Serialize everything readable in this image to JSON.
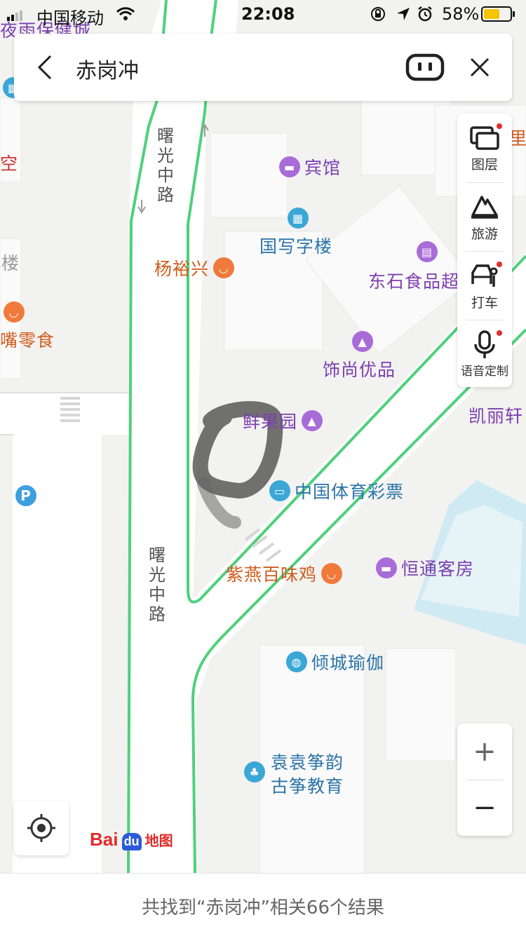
{
  "status_bar": {
    "carrier": "中国移动",
    "time": "22:08",
    "battery": "58%",
    "edge_label": "夜雨保健城"
  },
  "search": {
    "query": "赤岗冲"
  },
  "toolbar": {
    "items": [
      {
        "label": "图层",
        "icon": "layers-icon",
        "badge": true
      },
      {
        "label": "旅游",
        "icon": "travel-icon",
        "badge": false
      },
      {
        "label": "打车",
        "icon": "taxi-icon",
        "badge": true
      },
      {
        "label": "语音定制",
        "icon": "microphone-icon",
        "badge": true
      }
    ]
  },
  "roads": {
    "road1": "曙光中路",
    "road2": "曙光中路"
  },
  "pois": {
    "hotel1": "宾馆",
    "office": "国写字楼",
    "restaurant1": "杨裕兴",
    "food_store": "东石食品超",
    "snack": "嘴零食",
    "building": "楼",
    "accessories": "饰尚优品",
    "fruit": "鲜果园",
    "lottery": "中国体育彩票",
    "chicken": "紫燕百味鸡",
    "hotel2": "恒通客房",
    "yoga": "倾城瑜伽",
    "zither1": "袁袁筝韵",
    "zither2": "古筝教育",
    "right_top": "里",
    "left_top": "空",
    "kaili": "凯丽轩",
    "parking": "P"
  },
  "zoom": {
    "in": "+",
    "out": "−"
  },
  "logo": {
    "text1": "Bai",
    "text2": "du",
    "text3": "地图"
  },
  "footer": {
    "result_text": "共找到“赤岗冲”相关66个结果"
  },
  "colors": {
    "accent_green": "#4fd07c",
    "road_fill": "#ffffff",
    "map_bg": "#f2f2f0",
    "water": "#cfeaf2"
  }
}
